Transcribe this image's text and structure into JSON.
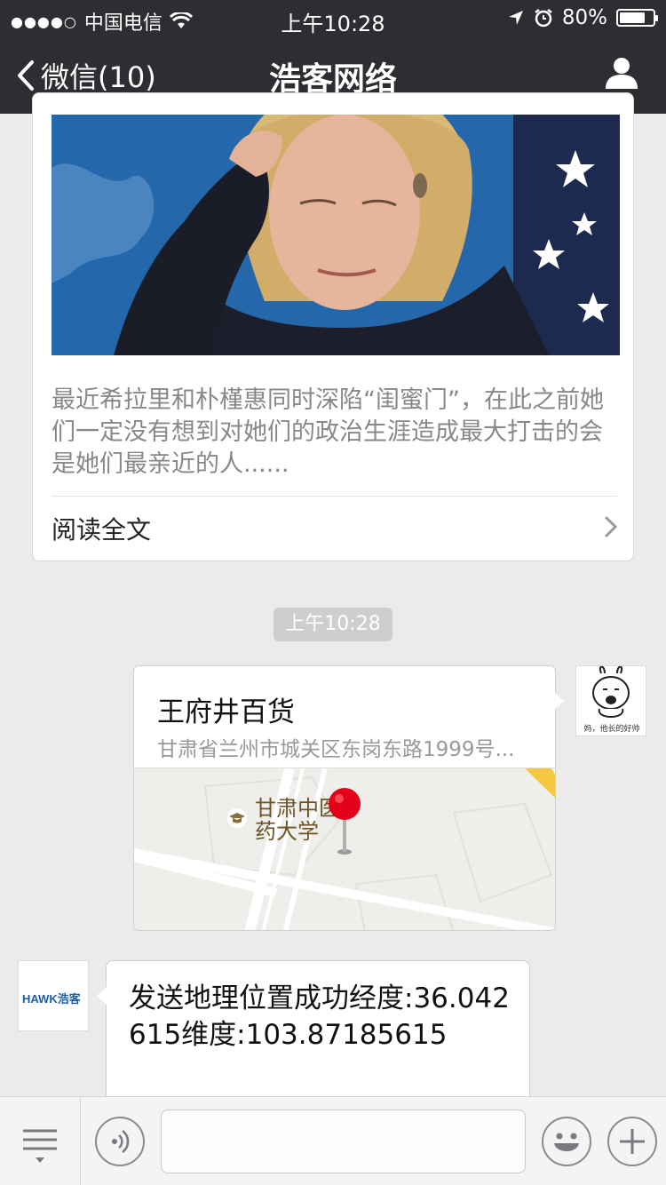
{
  "status_bar": {
    "signal_dots": "●●●●○",
    "carrier": "中国电信",
    "time": "上午10:28",
    "battery_percent": "80%",
    "battery_level": 0.8
  },
  "nav": {
    "back_label": "微信(10)",
    "title": "浩客网络"
  },
  "article": {
    "excerpt": "最近希拉里和朴槿惠同时深陷“闺蜜门”，在此之前她们一定没有想到对她们的政治生涯造成最大打击的会是她们最亲近的人......",
    "read_more": "阅读全文"
  },
  "timestamp": "上午10:28",
  "location_message": {
    "name": "王府井百货",
    "address": "甘肃省兰州市城关区东岗东路1999号...",
    "map_label_line1": "甘肃中医",
    "map_label_line2": "药大学"
  },
  "avatar_right_caption": "妈，他长的好帅",
  "incoming_message": {
    "sender_logo": "HAWK浩客",
    "text": "发送地理位置成功经度:36.042615维度:103.87185615"
  },
  "colors": {
    "nav_bg": "#2d2e32",
    "chat_bg": "#ebebeb",
    "pin_red": "#e4001b"
  },
  "icons": [
    "wifi-icon",
    "location-arrow-icon",
    "alarm-icon",
    "battery-icon",
    "back-chevron-icon",
    "user-icon",
    "chevron-right-icon",
    "school-icon",
    "map-pin-icon",
    "menu-icon",
    "voice-icon",
    "emoji-icon",
    "plus-icon"
  ]
}
